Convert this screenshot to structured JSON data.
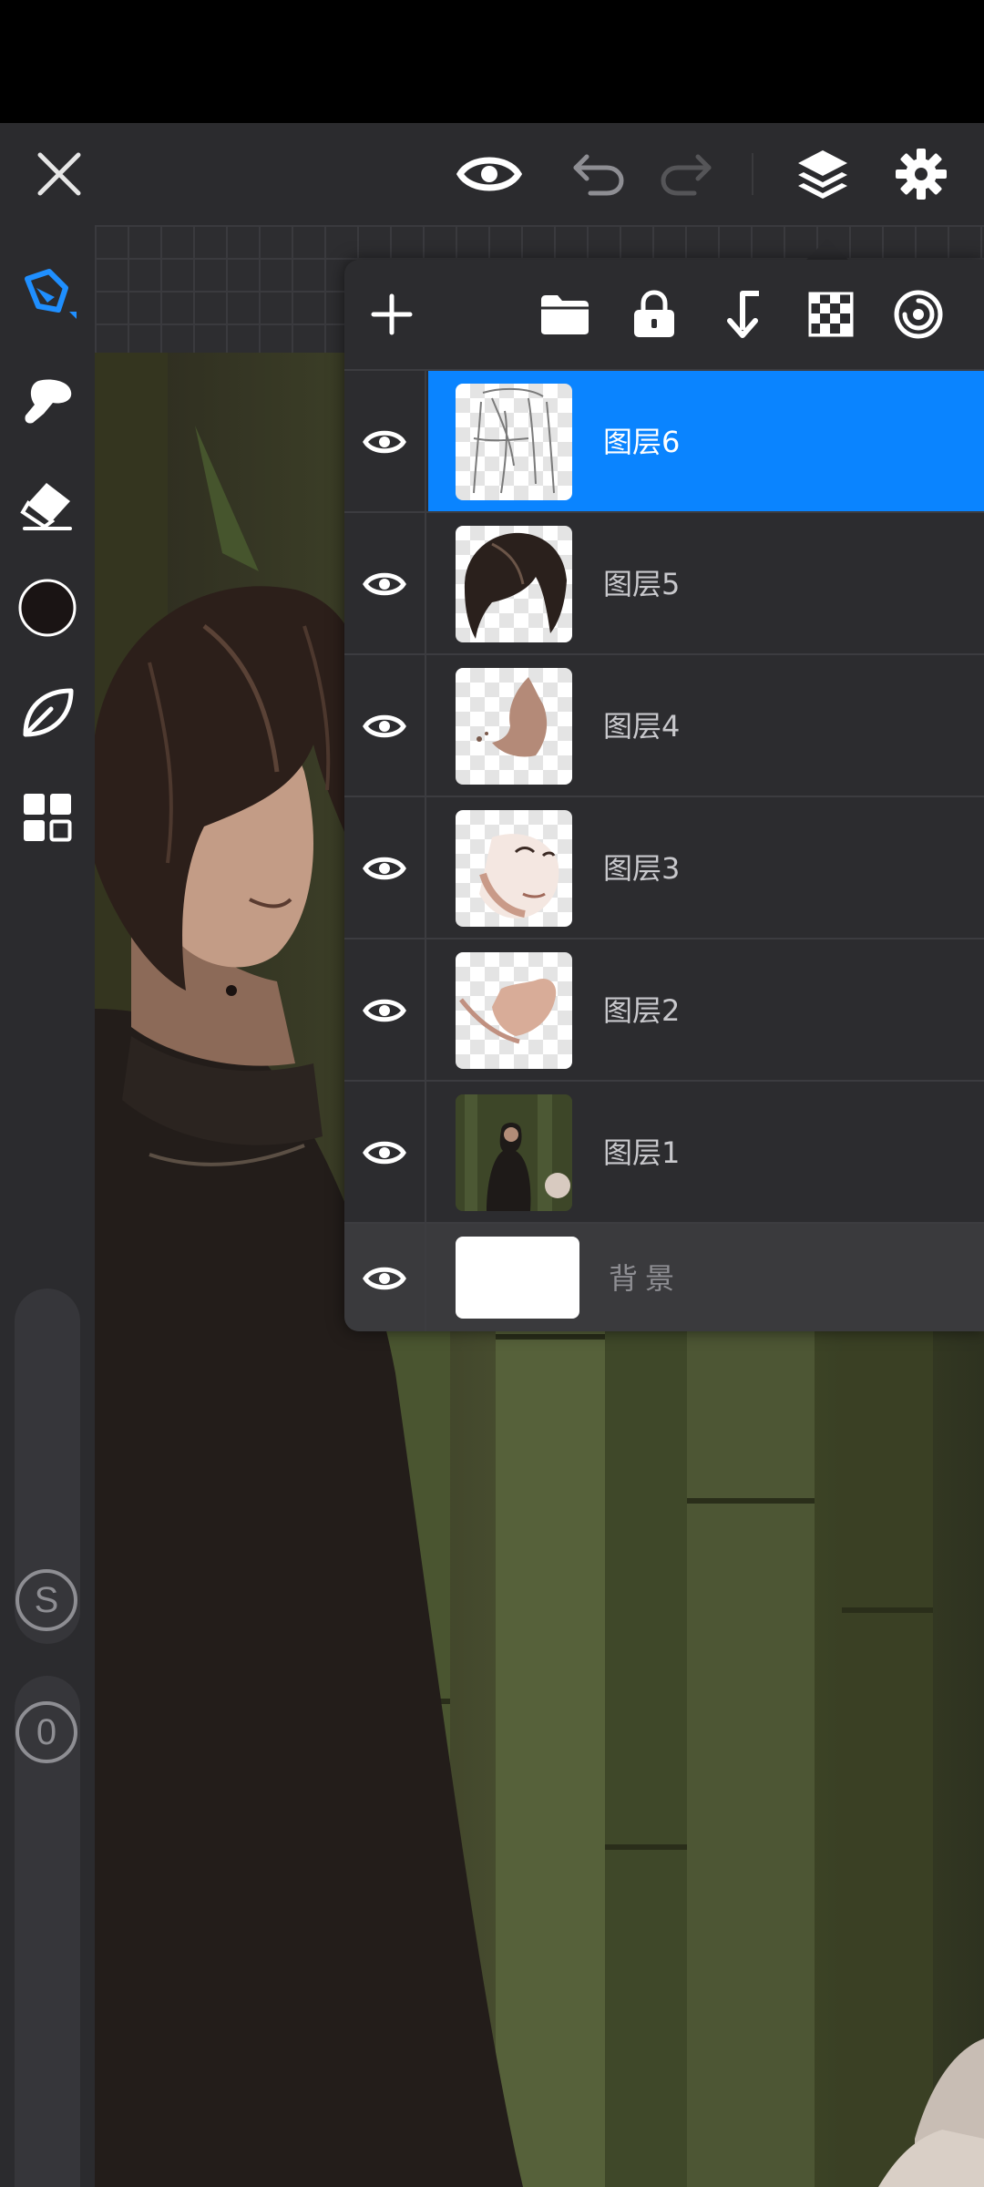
{
  "top_bar": {
    "close_icon": "close-icon",
    "preview_icon": "eye-icon",
    "undo_icon": "undo-icon",
    "redo_icon": "redo-icon",
    "layers_icon": "layers-icon",
    "settings_icon": "gear-icon"
  },
  "left_toolbar": {
    "tools": [
      "pen-icon",
      "smudge-icon",
      "eraser-icon",
      "color-swatch",
      "leaf-icon",
      "grid-icon"
    ],
    "current_color": "#1a1414",
    "size_slider_label": "S",
    "opacity_slider_label": "0"
  },
  "layers_panel": {
    "toolbar_icons": [
      "plus-icon",
      "folder-icon",
      "lock-icon",
      "merge-down-icon",
      "checker-icon",
      "target-icon"
    ],
    "layers": [
      {
        "name": "图层6",
        "selected": true,
        "visible": true
      },
      {
        "name": "图层5",
        "selected": false,
        "visible": true
      },
      {
        "name": "图层4",
        "selected": false,
        "visible": true
      },
      {
        "name": "图层3",
        "selected": false,
        "visible": true
      },
      {
        "name": "图层2",
        "selected": false,
        "visible": true
      },
      {
        "name": "图层1",
        "selected": false,
        "visible": true
      }
    ],
    "background": {
      "name": "背景",
      "visible": true
    }
  },
  "colors": {
    "accent": "#0a84ff",
    "panel": "#2c2c2f",
    "toolbar": "#2b2b2e"
  }
}
